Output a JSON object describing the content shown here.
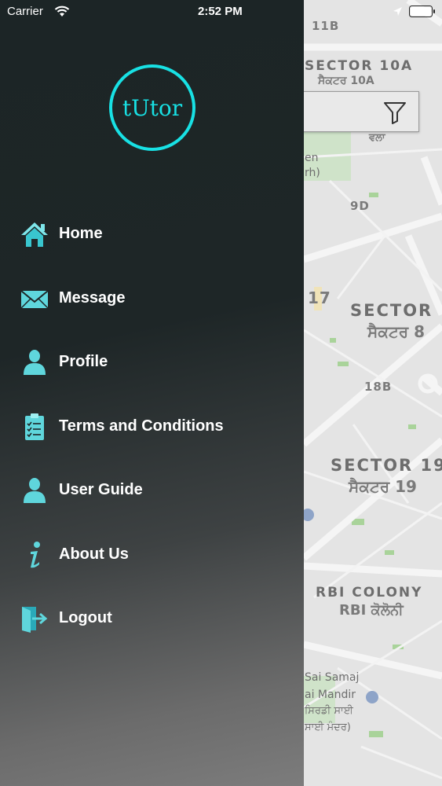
{
  "status_bar": {
    "carrier": "Carrier",
    "time": "2:52 PM"
  },
  "drawer": {
    "logo_text": "tUtor",
    "menu": [
      {
        "label": "Home",
        "icon": "home-icon"
      },
      {
        "label": "Message",
        "icon": "envelope-icon"
      },
      {
        "label": "Profile",
        "icon": "user-icon"
      },
      {
        "label": "Terms and Conditions",
        "icon": "clipboard-checklist-icon"
      },
      {
        "label": "User Guide",
        "icon": "user-icon"
      },
      {
        "label": "About Us",
        "icon": "info-icon"
      },
      {
        "label": "Logout",
        "icon": "logout-icon"
      }
    ]
  },
  "map": {
    "labels": {
      "s11b": "11B",
      "s10a": "SECTOR 10A",
      "s10a_pa": "ਸੈਕਟਰ 10A",
      "vala": "ਵਲਾ",
      "en": "en",
      "rh": "rh)",
      "s9d": "9D",
      "n17": "17",
      "sector": "SECTOR",
      "sector_pa": "ਸੈਕਟਰ 8",
      "s18b": "18B",
      "sector19": "SECTOR 19",
      "sector19_pa": "ਸੈਕਟਰ 19",
      "rbi": "RBI COLONY",
      "rbi_pa": "RBI ਕੋਲੋਨੀ",
      "sai1": "Sai Samaj",
      "sai2": "ai Mandir",
      "sai3": "ਸਿਰਡੀ ਸਾਈ",
      "sai4": "ਸਾਈ ਮੰਦਰ)"
    }
  },
  "colors": {
    "accent": "#18e1e4",
    "drawer_dark": "#1c2526"
  }
}
